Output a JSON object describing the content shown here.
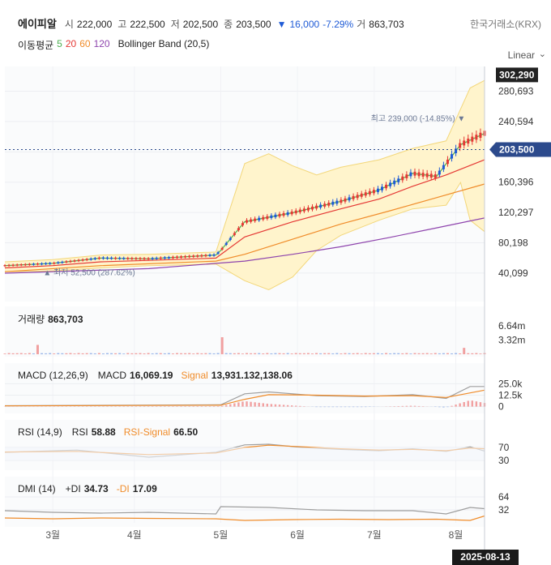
{
  "header": {
    "name": "에이피알",
    "open_label": "시",
    "open": "222,000",
    "high_label": "고",
    "high": "222,500",
    "low_label": "저",
    "low": "202,500",
    "close_label": "종",
    "close": "203,500",
    "change_arrow": "▼",
    "change": "16,000",
    "change_pct": "-7.29%",
    "volume_label": "거",
    "volume": "863,703",
    "exchange": "한국거래소(KRX)",
    "scale": "Linear",
    "scale_icon": "chevron-down-icon"
  },
  "indicators": {
    "ma_label": "이동평균",
    "ma_periods": [
      "5",
      "20",
      "60",
      "120"
    ],
    "ma_colors": [
      "#4caf50",
      "#e53935",
      "#f08c2a",
      "#8e44ad"
    ],
    "bb_label": "Bollinger Band (20,5)"
  },
  "colors": {
    "up": "#e53935",
    "down": "#1f5bd6",
    "price_badge": "#2c4a8c",
    "bb_fill": "#fff4cc",
    "bb_line": "#f3d77a"
  },
  "panels": {
    "volume": {
      "label": "거래량",
      "value": "863,703"
    },
    "macd": {
      "label": "MACD (12,26,9)",
      "macd_label": "MACD",
      "macd_value": "16,069.19",
      "signal_label": "Signal",
      "signal_value": "13,931.132,138.06"
    },
    "rsi": {
      "label": "RSI (14,9)",
      "rsi_label": "RSI",
      "rsi_value": "58.88",
      "signal_label": "RSI-Signal",
      "signal_value": "66.50"
    },
    "dmi": {
      "label": "DMI (14)",
      "pdi_label": "+DI",
      "pdi_value": "34.73",
      "mdi_label": "-DI",
      "mdi_value": "17.09"
    }
  },
  "footer": {
    "current_date": "2025-08-13"
  },
  "chart_data": [
    {
      "type": "candlestick",
      "title": "에이피알",
      "y_ticks": [
        "280,693",
        "240,594",
        "200,495",
        "160,396",
        "120,297",
        "80,198",
        "40,099"
      ],
      "y_tick_values": [
        280693,
        240594,
        200495,
        160396,
        120297,
        80198,
        40099
      ],
      "ylim": [
        10000,
        307000
      ],
      "x_ticks": [
        "3월",
        "4월",
        "5월",
        "6월",
        "7월",
        "8월"
      ],
      "x_tick_positions": [
        0.1,
        0.27,
        0.45,
        0.61,
        0.77,
        0.94
      ],
      "last_price": "203,500",
      "last_price_value": 203500,
      "top_value": "302,290",
      "top_value_number": 302290,
      "annotations": [
        {
          "label": "최고 239,000 (-14.85%)",
          "value": 239000,
          "marker": "▼"
        },
        {
          "label": "최저 52,500 (287.62%)",
          "value": 52500,
          "marker": "▲"
        }
      ],
      "series": [
        {
          "name": "5",
          "kind": "ma",
          "points": [
            [
              0,
              50000
            ],
            [
              0.1,
              53000
            ],
            [
              0.2,
              60000
            ],
            [
              0.3,
              59000
            ],
            [
              0.44,
              64000
            ],
            [
              0.45,
              70000
            ],
            [
              0.5,
              108000
            ],
            [
              0.6,
              120000
            ],
            [
              0.7,
              135000
            ],
            [
              0.78,
              150000
            ],
            [
              0.85,
              172000
            ],
            [
              0.9,
              168000
            ],
            [
              0.95,
              210000
            ],
            [
              1,
              225000
            ]
          ]
        },
        {
          "name": "20",
          "kind": "ma",
          "points": [
            [
              0,
              47000
            ],
            [
              0.1,
              50000
            ],
            [
              0.2,
              55000
            ],
            [
              0.3,
              57000
            ],
            [
              0.44,
              60000
            ],
            [
              0.5,
              88000
            ],
            [
              0.6,
              108000
            ],
            [
              0.7,
              125000
            ],
            [
              0.78,
              138000
            ],
            [
              0.85,
              155000
            ],
            [
              0.92,
              170000
            ],
            [
              1,
              190000
            ]
          ]
        },
        {
          "name": "60",
          "kind": "ma",
          "points": [
            [
              0,
              42000
            ],
            [
              0.2,
              50000
            ],
            [
              0.44,
              56000
            ],
            [
              0.5,
              65000
            ],
            [
              0.6,
              85000
            ],
            [
              0.7,
              105000
            ],
            [
              0.8,
              122000
            ],
            [
              0.9,
              140000
            ],
            [
              1,
              158000
            ]
          ]
        },
        {
          "name": "120",
          "kind": "ma",
          "points": [
            [
              0,
              40000
            ],
            [
              0.3,
              46000
            ],
            [
              0.5,
              56000
            ],
            [
              0.6,
              65000
            ],
            [
              0.7,
              75000
            ],
            [
              0.8,
              87000
            ],
            [
              0.9,
              100000
            ],
            [
              1,
              113000
            ]
          ]
        },
        {
          "name": "bb_upper",
          "kind": "band",
          "points": [
            [
              0,
              55000
            ],
            [
              0.1,
              58000
            ],
            [
              0.2,
              64000
            ],
            [
              0.3,
              65000
            ],
            [
              0.44,
              68000
            ],
            [
              0.5,
              185000
            ],
            [
              0.55,
              198000
            ],
            [
              0.6,
              182000
            ],
            [
              0.65,
              170000
            ],
            [
              0.7,
              180000
            ],
            [
              0.78,
              190000
            ],
            [
              0.85,
              205000
            ],
            [
              0.92,
              215000
            ],
            [
              0.97,
              285000
            ],
            [
              1,
              295000
            ]
          ]
        },
        {
          "name": "bb_lower",
          "kind": "band",
          "points": [
            [
              0,
              42000
            ],
            [
              0.1,
              43000
            ],
            [
              0.2,
              47000
            ],
            [
              0.3,
              50000
            ],
            [
              0.44,
              52000
            ],
            [
              0.5,
              30000
            ],
            [
              0.55,
              18000
            ],
            [
              0.6,
              35000
            ],
            [
              0.65,
              70000
            ],
            [
              0.7,
              90000
            ],
            [
              0.78,
              110000
            ],
            [
              0.85,
              125000
            ],
            [
              0.92,
              130000
            ],
            [
              0.95,
              160000
            ],
            [
              0.97,
              110000
            ],
            [
              1,
              95000
            ]
          ]
        }
      ]
    },
    {
      "type": "bar",
      "title": "거래량",
      "y_ticks": [
        "6.64m",
        "3.32m"
      ],
      "ylim": [
        0,
        8000000
      ],
      "spikes": [
        {
          "x": 0.07,
          "value": 2200000
        },
        {
          "x": 0.45,
          "value": 4000000
        },
        {
          "x": 0.96,
          "value": 1500000
        }
      ]
    },
    {
      "type": "line",
      "title": "MACD (12,26,9)",
      "y_ticks": [
        "25.0k",
        "12.5k",
        "0"
      ],
      "ylim": [
        -3000,
        28000
      ],
      "series": [
        {
          "name": "MACD",
          "points": [
            [
              0,
              1000
            ],
            [
              0.45,
              2000
            ],
            [
              0.5,
              14000
            ],
            [
              0.55,
              16000
            ],
            [
              0.65,
              12000
            ],
            [
              0.75,
              11000
            ],
            [
              0.85,
              13000
            ],
            [
              0.92,
              9000
            ],
            [
              0.97,
              22000
            ],
            [
              1,
              22000
            ]
          ]
        },
        {
          "name": "Signal",
          "points": [
            [
              0,
              800
            ],
            [
              0.45,
              1500
            ],
            [
              0.5,
              8000
            ],
            [
              0.55,
              13000
            ],
            [
              0.65,
              12500
            ],
            [
              0.75,
              11500
            ],
            [
              0.85,
              12000
            ],
            [
              0.92,
              10000
            ],
            [
              0.97,
              15000
            ],
            [
              1,
              18000
            ]
          ]
        }
      ]
    },
    {
      "type": "line",
      "title": "RSI (14,9)",
      "y_ticks": [
        "70",
        "30"
      ],
      "ylim": [
        0,
        100
      ],
      "series": [
        {
          "name": "RSI",
          "points": [
            [
              0,
              55
            ],
            [
              0.15,
              62
            ],
            [
              0.3,
              40
            ],
            [
              0.44,
              55
            ],
            [
              0.5,
              78
            ],
            [
              0.55,
              80
            ],
            [
              0.62,
              70
            ],
            [
              0.7,
              64
            ],
            [
              0.78,
              60
            ],
            [
              0.85,
              66
            ],
            [
              0.92,
              58
            ],
            [
              0.97,
              72
            ],
            [
              1,
              59
            ]
          ]
        },
        {
          "name": "RSI-Signal",
          "points": [
            [
              0,
              56
            ],
            [
              0.15,
              58
            ],
            [
              0.3,
              48
            ],
            [
              0.44,
              53
            ],
            [
              0.5,
              70
            ],
            [
              0.55,
              77
            ],
            [
              0.62,
              72
            ],
            [
              0.7,
              66
            ],
            [
              0.78,
              62
            ],
            [
              0.85,
              64
            ],
            [
              0.92,
              60
            ],
            [
              0.97,
              68
            ],
            [
              1,
              66
            ]
          ]
        }
      ]
    },
    {
      "type": "line",
      "title": "DMI (14)",
      "y_ticks": [
        "64",
        "32"
      ],
      "ylim": [
        0,
        80
      ],
      "series": [
        {
          "name": "+DI",
          "points": [
            [
              0,
              30
            ],
            [
              0.1,
              26
            ],
            [
              0.2,
              24
            ],
            [
              0.3,
              26
            ],
            [
              0.44,
              22
            ],
            [
              0.45,
              40
            ],
            [
              0.55,
              38
            ],
            [
              0.65,
              32
            ],
            [
              0.75,
              30
            ],
            [
              0.85,
              30
            ],
            [
              0.92,
              22
            ],
            [
              0.97,
              38
            ],
            [
              1,
              35
            ]
          ]
        },
        {
          "name": "-DI",
          "points": [
            [
              0,
              12
            ],
            [
              0.1,
              10
            ],
            [
              0.2,
              12
            ],
            [
              0.3,
              11
            ],
            [
              0.44,
              10
            ],
            [
              0.5,
              6
            ],
            [
              0.6,
              8
            ],
            [
              0.7,
              9
            ],
            [
              0.8,
              8
            ],
            [
              0.9,
              9
            ],
            [
              0.97,
              6
            ],
            [
              1,
              17
            ]
          ]
        }
      ]
    }
  ]
}
